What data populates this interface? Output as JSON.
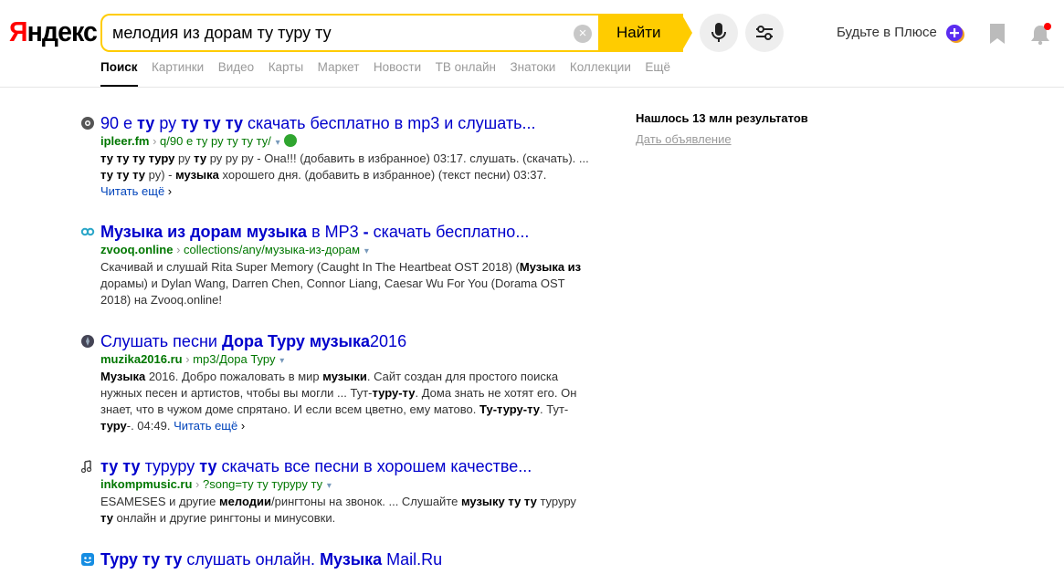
{
  "header": {
    "logo_first": "Я",
    "logo_rest": "ндекс",
    "search": {
      "value": "мелодия из дорам ту туру ту",
      "clear_label": "×",
      "button_label": "Найти"
    },
    "plus_label": "Будьте в Плюсе",
    "icons": {
      "mic": "microphone-icon",
      "settings": "sliders-icon",
      "plus": "plus-badge-icon",
      "bookmark": "bookmark-icon",
      "bell": "bell-icon"
    },
    "colors": {
      "accent": "#ffcc00",
      "logo_red": "#ff0000",
      "notification": "#ff0000"
    }
  },
  "tabs": [
    {
      "label": "Поиск",
      "active": true
    },
    {
      "label": "Картинки"
    },
    {
      "label": "Видео"
    },
    {
      "label": "Карты"
    },
    {
      "label": "Маркет"
    },
    {
      "label": "Новости"
    },
    {
      "label": "ТВ онлайн"
    },
    {
      "label": "Знатоки"
    },
    {
      "label": "Коллекции"
    },
    {
      "label": "Ещё"
    }
  ],
  "sidebar": {
    "found": "Нашлось 13 млн результатов",
    "advertise": "Дать объявление"
  },
  "results": [
    {
      "icon": "ipleer-icon",
      "title": [
        "90 е ",
        {
          "b": "ту"
        },
        " ру ",
        {
          "b": "ту ту ту"
        },
        " скачать бесплатно в mp3 и слушать..."
      ],
      "domain": "ipleer.fm",
      "path": "q/90 е ту ру ту ту ту/",
      "verified": true,
      "text": [
        {
          "b": "ту ту ту туру"
        },
        " ру ",
        {
          "b": "ту"
        },
        " ру ру ру - Она!!! (добавить в избранное) 03:17. слушать. (скачать). ... ",
        {
          "b": "ту ту ту"
        },
        " ру) - ",
        {
          "b": "музыка"
        },
        " хорошего дня. (добавить в избранное) (текст песни) 03:37."
      ],
      "more": "Читать ещё",
      "more_newline": true
    },
    {
      "icon": "zvooq-icon",
      "title": [
        {
          "b": "Музыка из дорам музыка"
        },
        " в MP3 ",
        {
          "b": "-"
        },
        " скачать бесплатно..."
      ],
      "domain": "zvooq.online",
      "path": "collections/any/музыка-из-дорам",
      "verified": false,
      "text": [
        "Скачивай и слушай Rita Super Memory (Caught In The Heartbeat OST 2018) (",
        {
          "b": "Музыка из"
        },
        " дорамы) и Dylan Wang, Darren Chen, Connor Liang, Caesar Wu For You (Dorama OST 2018) на Zvooq.online!"
      ],
      "more": "",
      "more_newline": false
    },
    {
      "icon": "muzika2016-icon",
      "title": [
        "Слушать песни ",
        {
          "b": "Дора Туру музыка"
        },
        "2016"
      ],
      "domain": "muzika2016.ru",
      "path": "mp3/Дора Туру",
      "verified": false,
      "text": [
        {
          "b": "Музыка"
        },
        " 2016. Добро пожаловать в мир ",
        {
          "b": "музыки"
        },
        ". Сайт создан для простого поиска нужных песен и артистов, чтобы вы могли ... Тут-",
        {
          "b": "туру-ту"
        },
        ". Дома знать не хотят его. Он знает, что в чужом доме спрятано. И если всем цветно, ему матово. ",
        {
          "b": "Ту-туру-ту"
        },
        ". Тут-",
        {
          "b": "туру"
        },
        "-. 04:49. "
      ],
      "more": "Читать ещё",
      "more_newline": false
    },
    {
      "icon": "music-note-icon",
      "title": [
        {
          "b": "ту ту"
        },
        " туруру ",
        {
          "b": "ту"
        },
        " скачать все песни в хорошем качестве..."
      ],
      "domain": "inkompmusic.ru",
      "path": "?song=ту ту туруру ту",
      "verified": false,
      "text": [
        "ESAMESES и другие ",
        {
          "b": "мелодии"
        },
        "/рингтоны на звонок. ... Слушайте ",
        {
          "b": "музыку ту ту"
        },
        " туруру ",
        {
          "b": "ту"
        },
        " онлайн и другие рингтоны и минусовки."
      ],
      "more": "",
      "more_newline": false
    },
    {
      "icon": "mailru-icon",
      "title": [
        {
          "b": "Туру ту ту"
        },
        " слушать онлайн. ",
        {
          "b": "Музыка"
        },
        " Mail.Ru"
      ],
      "domain": "",
      "path": "",
      "verified": false,
      "text": [],
      "more": "",
      "more_newline": false
    }
  ]
}
